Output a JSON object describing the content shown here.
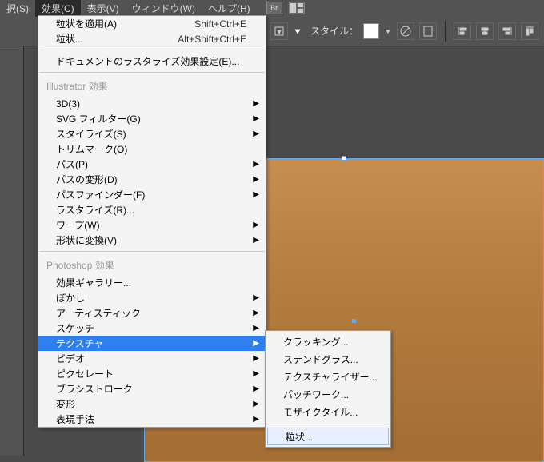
{
  "menubar": {
    "items": [
      {
        "label": "択(S)"
      },
      {
        "label": "効果(C)"
      },
      {
        "label": "表示(V)"
      },
      {
        "label": "ウィンドウ(W)"
      },
      {
        "label": "ヘルプ(H)"
      }
    ]
  },
  "toolbar": {
    "style_label": "スタイル："
  },
  "menu": {
    "apply_grain": "粒状を適用(A)",
    "apply_grain_shortcut": "Shift+Ctrl+E",
    "grain": "粒状...",
    "grain_shortcut": "Alt+Shift+Ctrl+E",
    "doc_raster": "ドキュメントのラスタライズ効果設定(E)...",
    "illustrator_header": "Illustrator 効果",
    "illustrator_items": [
      {
        "label": "3D(3)",
        "arrow": true
      },
      {
        "label": "SVG フィルター(G)",
        "arrow": true
      },
      {
        "label": "スタイライズ(S)",
        "arrow": true
      },
      {
        "label": "トリムマーク(O)",
        "arrow": false
      },
      {
        "label": "パス(P)",
        "arrow": true
      },
      {
        "label": "パスの変形(D)",
        "arrow": true
      },
      {
        "label": "パスファインダー(F)",
        "arrow": true
      },
      {
        "label": "ラスタライズ(R)...",
        "arrow": false
      },
      {
        "label": "ワープ(W)",
        "arrow": true
      },
      {
        "label": "形状に変換(V)",
        "arrow": true
      }
    ],
    "photoshop_header": "Photoshop 効果",
    "photoshop_items": [
      {
        "label": "効果ギャラリー...",
        "arrow": false
      },
      {
        "label": "ぼかし",
        "arrow": true
      },
      {
        "label": "アーティスティック",
        "arrow": true
      },
      {
        "label": "スケッチ",
        "arrow": true
      },
      {
        "label": "テクスチャ",
        "arrow": true,
        "highlighted": true
      },
      {
        "label": "ビデオ",
        "arrow": true
      },
      {
        "label": "ピクセレート",
        "arrow": true
      },
      {
        "label": "ブラシストローク",
        "arrow": true
      },
      {
        "label": "変形",
        "arrow": true
      },
      {
        "label": "表現手法",
        "arrow": true
      }
    ]
  },
  "submenu": {
    "items": [
      {
        "label": "クラッキング..."
      },
      {
        "label": "ステンドグラス..."
      },
      {
        "label": "テクスチャライザー..."
      },
      {
        "label": "パッチワーク..."
      },
      {
        "label": "モザイクタイル..."
      },
      {
        "label": "粒状...",
        "boxed": true
      }
    ]
  }
}
